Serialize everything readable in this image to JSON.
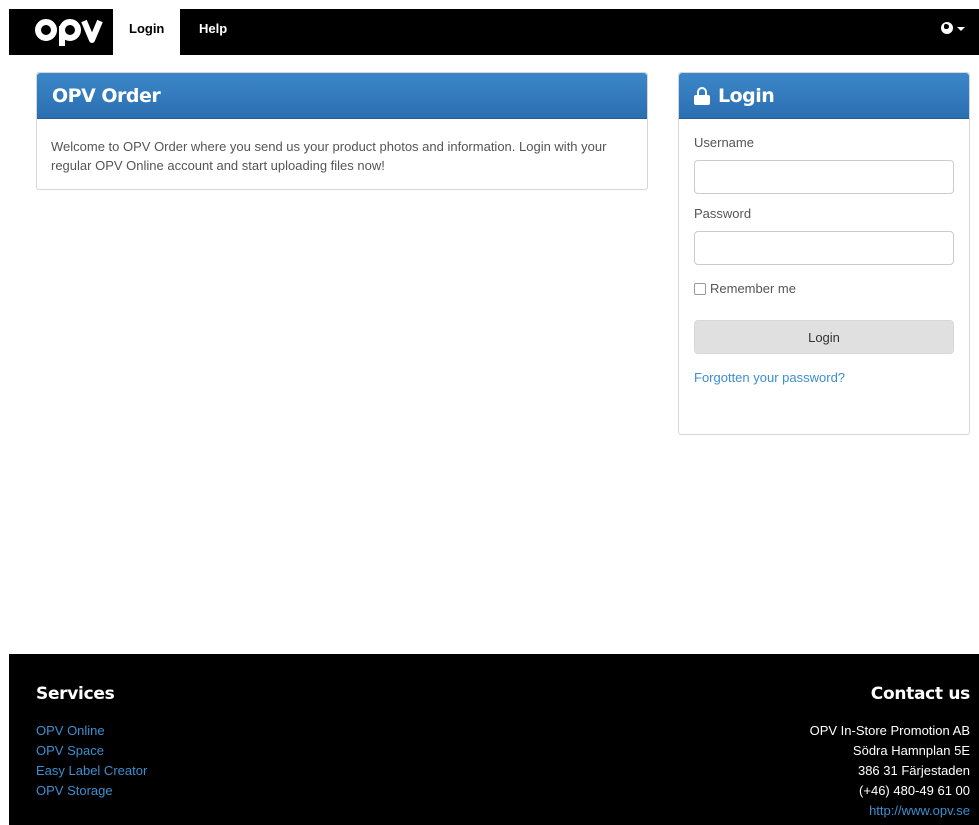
{
  "nav": {
    "logo": "opv",
    "tabs": [
      {
        "label": "Login",
        "active": true
      },
      {
        "label": "Help",
        "active": false
      }
    ],
    "language_icon": "globe-icon"
  },
  "order_panel": {
    "title": "OPV Order",
    "body": "Welcome to OPV Order where you send us your product photos and information. Login with your regular OPV Online account and start uploading files now!"
  },
  "login_panel": {
    "title": "Login",
    "icon": "lock-icon",
    "username_label": "Username",
    "username_value": "",
    "password_label": "Password",
    "password_value": "",
    "remember_label": "Remember me",
    "remember_checked": false,
    "button_label": "Login",
    "forgot_label": "Forgotten your password?"
  },
  "footer": {
    "services_title": "Services",
    "services": [
      "OPV Online",
      "OPV Space",
      "Easy Label Creator",
      "OPV Storage"
    ],
    "contact_title": "Contact us",
    "contact_lines": [
      "OPV In-Store Promotion AB",
      "Södra Hamnplan 5E",
      "386 31 Färjestaden",
      "(+46) 480-49 61 00"
    ],
    "contact_link": "http://www.opv.se"
  },
  "colors": {
    "header_bg": "#000000",
    "panel_header": "#2f78bd",
    "link": "#3c8fd0",
    "footer_bg": "#000000"
  }
}
